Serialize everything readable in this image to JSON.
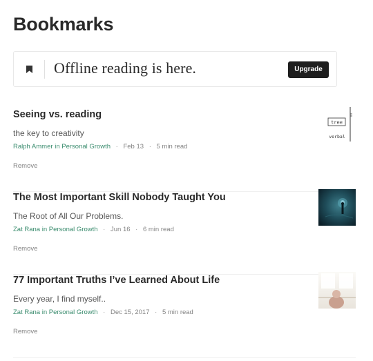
{
  "page": {
    "title": "Bookmarks"
  },
  "promo": {
    "text": "Offline reading is here.",
    "button": "Upgrade",
    "icon": "bookmark-icon"
  },
  "bookmarks": [
    {
      "title": "Seeing vs. reading",
      "subtitle": "the key to creativity",
      "author": "Ralph Ammer",
      "in": "in",
      "publication": "Personal Growth",
      "date": "Feb 13",
      "read_time": "5 min read",
      "remove": "Remove",
      "thumb": {
        "word1": "tree",
        "word2": "verbal"
      }
    },
    {
      "title": "The Most Important Skill Nobody Taught You",
      "subtitle": "The Root of All Our Problems.",
      "author": "Zat Rana",
      "in": "in",
      "publication": "Personal Growth",
      "date": "Jun 16",
      "read_time": "6 min read",
      "remove": "Remove"
    },
    {
      "title": "77 Important Truths I’ve Learned About Life",
      "subtitle": "Every year, I find myself..",
      "author": "Zat Rana",
      "in": "in",
      "publication": "Personal Growth",
      "date": "Dec 15, 2017",
      "read_time": "5 min read",
      "remove": "Remove"
    }
  ],
  "colors": {
    "accent_green": "#3a8c6e",
    "button_dark": "#1e1e1e"
  }
}
